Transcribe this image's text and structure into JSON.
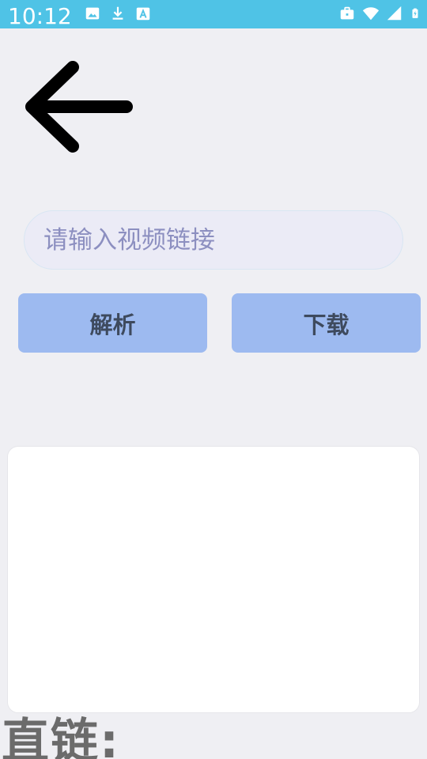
{
  "status_bar": {
    "time": "10:12",
    "background_color": "#4fc3e6",
    "left_icons": [
      "image-icon",
      "download-icon",
      "accessibility-a-icon"
    ],
    "right_icons": [
      "work-profile-briefcase-icon",
      "wifi-icon",
      "cellular-signal-icon",
      "battery-charging-icon"
    ]
  },
  "header": {
    "back_icon": "arrow-left-icon"
  },
  "form": {
    "url_input": {
      "value": "",
      "placeholder": "请输入视频链接"
    },
    "parse_button_label": "解析",
    "download_button_label": "下载",
    "button_color": "#9dbaf0"
  },
  "result": {
    "direct_link_label": "直链:"
  }
}
